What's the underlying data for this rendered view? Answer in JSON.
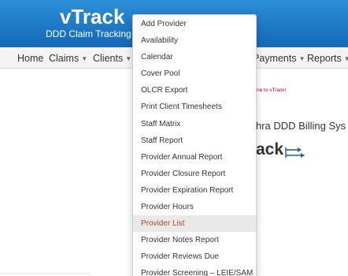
{
  "header": {
    "brand": "vTrack",
    "tagline": "DDD Claim Tracking ar"
  },
  "nav": [
    {
      "label": "Home",
      "has_caret": false
    },
    {
      "label": "Claims",
      "has_caret": true
    },
    {
      "label": "Clients",
      "has_caret": true
    },
    {
      "label": "Payments",
      "has_caret": true
    },
    {
      "label": "Reports",
      "has_caret": true
    }
  ],
  "main": {
    "welcome": "ne to vTrack!",
    "system_title": "hra DDD Billing Sys",
    "brand_partial": "ack"
  },
  "dropdown": {
    "items": [
      {
        "label": "Add Provider"
      },
      {
        "label": "Availability"
      },
      {
        "label": "Calendar"
      },
      {
        "label": "Cover Pool"
      },
      {
        "label": "OLCR Export"
      },
      {
        "label": "Print Client Timesheets"
      },
      {
        "label": "Staff Matrix"
      },
      {
        "label": "Staff Report"
      },
      {
        "label": "Provider Annual Report"
      },
      {
        "label": "Provider Closure Report"
      },
      {
        "label": "Provider Expiration Report"
      },
      {
        "label": "Provider Hours"
      },
      {
        "label": "Provider List",
        "active": true
      },
      {
        "label": "Provider Notes Report"
      },
      {
        "label": "Provider Reviews Due"
      },
      {
        "label": "Provider Screening – LEIE/SAM"
      }
    ]
  },
  "colors": {
    "header_top": "#2d8fd6",
    "header_bottom": "#1468b8",
    "welcome_red": "#cc0000",
    "active_item_text": "#b34a1c",
    "active_item_bg": "#e9e9e9",
    "arrow_blue": "#1e5fb0"
  }
}
